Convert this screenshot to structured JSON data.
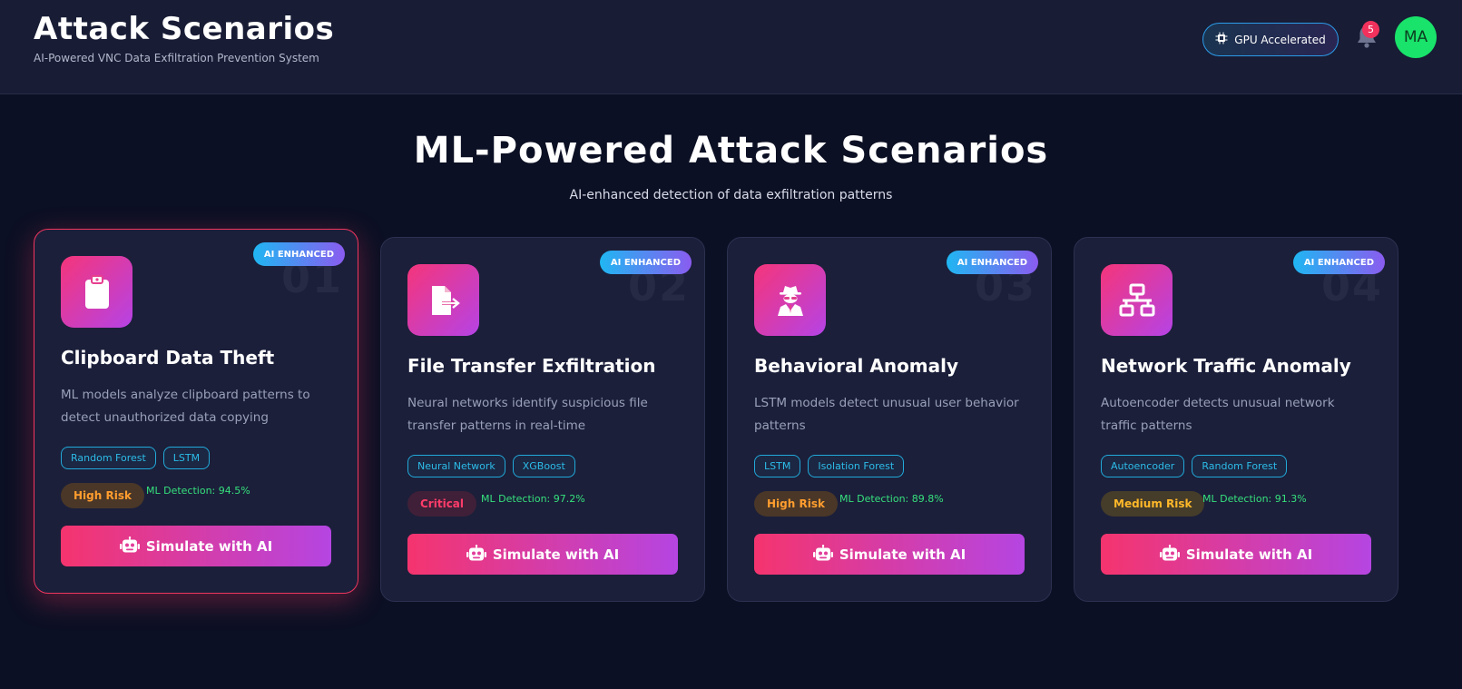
{
  "header": {
    "title": "Attack Scenarios",
    "subtitle": "AI-Powered VNC Data Exfiltration Prevention System",
    "gpu_label": "GPU Accelerated",
    "notification_count": "5",
    "avatar_initials": "MA"
  },
  "section": {
    "title": "ML-Powered Attack Scenarios",
    "subtitle": "AI-enhanced detection of data exfiltration patterns"
  },
  "colors": {
    "background": "#0c1024",
    "card": "#1b1f3a",
    "accent_pink": "#f5346e",
    "accent_purple": "#b545e2",
    "detection_green": "#36e07c",
    "tag_cyan": "#2dbce8"
  },
  "cards": [
    {
      "badge": "AI ENHANCED",
      "number": "01",
      "icon": "clipboard-icon",
      "title": "Clipboard Data Theft",
      "description": "ML models analyze clipboard patterns to detect unauthorized data copying",
      "tags": [
        "Random Forest",
        "LSTM"
      ],
      "risk": "High Risk",
      "detection": "ML Detection: 94.5%",
      "button": "Simulate with AI"
    },
    {
      "badge": "AI ENHANCED",
      "number": "02",
      "icon": "file-export-icon",
      "title": "File Transfer Exfiltration",
      "description": "Neural networks identify suspicious file transfer patterns in real-time",
      "tags": [
        "Neural Network",
        "XGBoost"
      ],
      "risk": "Critical",
      "detection": "ML Detection: 97.2%",
      "button": "Simulate with AI"
    },
    {
      "badge": "AI ENHANCED",
      "number": "03",
      "icon": "user-secret-icon",
      "title": "Behavioral Anomaly",
      "description": "LSTM models detect unusual user behavior patterns",
      "tags": [
        "LSTM",
        "Isolation Forest"
      ],
      "risk": "High Risk",
      "detection": "ML Detection: 89.8%",
      "button": "Simulate with AI"
    },
    {
      "badge": "AI ENHANCED",
      "number": "04",
      "icon": "network-icon",
      "title": "Network Traffic Anomaly",
      "description": "Autoencoder detects unusual network traffic patterns",
      "tags": [
        "Autoencoder",
        "Random Forest"
      ],
      "risk": "Medium Risk",
      "detection": "ML Detection: 91.3%",
      "button": "Simulate with AI"
    }
  ]
}
